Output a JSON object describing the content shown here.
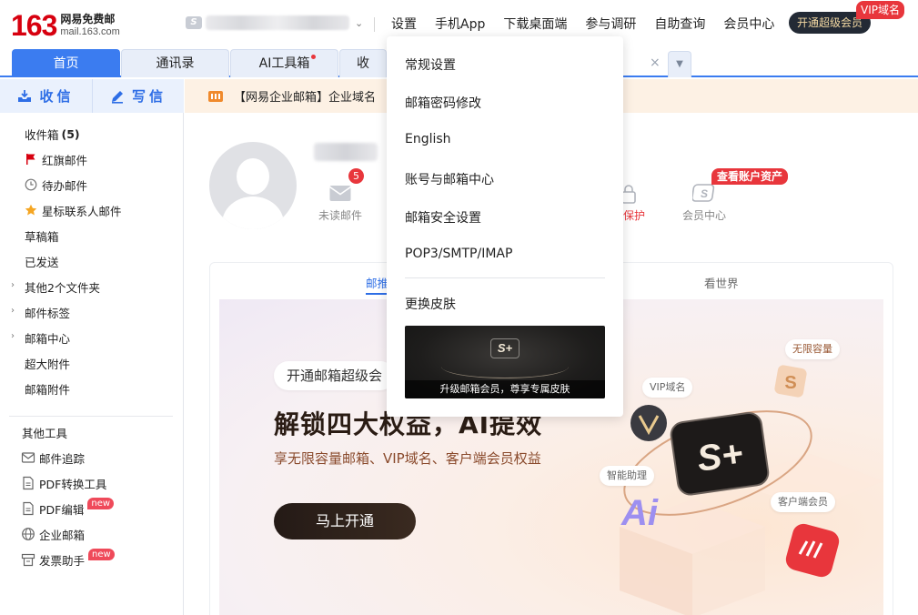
{
  "header": {
    "logo_number": "163",
    "logo_name": "网易免费邮",
    "logo_url": "mail.163.com",
    "account_badge": "S",
    "nav": [
      "设置",
      "手机App",
      "下载桌面端",
      "参与调研",
      "自助查询",
      "会员中心"
    ],
    "vip_button": "开通超级会员",
    "vip_tag": "VIP域名"
  },
  "tabs": [
    {
      "label": "首页",
      "active": true
    },
    {
      "label": "通讯录",
      "active": false
    },
    {
      "label": "AI工具箱",
      "active": false,
      "dot": true
    },
    {
      "label": "收",
      "active": false
    }
  ],
  "sidebar": {
    "receive": "收信",
    "write": "写信",
    "folders": [
      {
        "label": "收件箱",
        "count": "(5)",
        "icon": "none"
      },
      {
        "label": "红旗邮件",
        "icon": "red-flag-icon"
      },
      {
        "label": "待办邮件",
        "icon": "clock-icon"
      },
      {
        "label": "星标联系人邮件",
        "icon": "star-icon"
      },
      {
        "label": "草稿箱",
        "icon": "none"
      },
      {
        "label": "已发送",
        "icon": "none"
      },
      {
        "label": "其他2个文件夹",
        "icon": "chevron"
      },
      {
        "label": "邮件标签",
        "icon": "chevron"
      },
      {
        "label": "邮箱中心",
        "icon": "chevron"
      },
      {
        "label": "超大附件",
        "icon": "none"
      },
      {
        "label": "邮箱附件",
        "icon": "none"
      }
    ],
    "tools_title": "其他工具",
    "tools": [
      {
        "label": "邮件追踪",
        "icon": "mail-track-icon"
      },
      {
        "label": "PDF转换工具",
        "icon": "pdf-icon"
      },
      {
        "label": "PDF编辑",
        "icon": "pdf-icon",
        "new": "new"
      },
      {
        "label": "企业邮箱",
        "icon": "globe-icon"
      },
      {
        "label": "发票助手",
        "icon": "invoice-icon",
        "new": "new"
      }
    ]
  },
  "notice": {
    "text": "【网易企业邮箱】企业域名"
  },
  "stats": {
    "unread_count": "5",
    "unread_label": "未读邮件",
    "login_protect_label": "录保护",
    "member_label": "会员中心",
    "asset_tag": "查看账户资产"
  },
  "feed": {
    "tab_left": "邮推",
    "tab_right": "看世界"
  },
  "promo": {
    "pill": "开通邮箱超级会",
    "title": "解锁四大权益，AI提效",
    "subtitle": "享无限容量邮箱、VIP域名、客户端会员权益",
    "button": "马上开通",
    "chips": [
      "无限容量",
      "VIP域名",
      "智能助理",
      "客户端会员"
    ],
    "badge_text": "S+",
    "ai_text": "Ai"
  },
  "dropdown": {
    "items": [
      "常规设置",
      "邮箱密码修改",
      "English",
      "账号与邮箱中心",
      "邮箱安全设置",
      "POP3/SMTP/IMAP"
    ],
    "skin_label": "更换皮肤",
    "skin_logo": "S+",
    "skin_caption": "升级邮箱会员，尊享专属皮肤"
  },
  "colors": {
    "brand_red": "#d7000f",
    "tab_blue": "#3b7cf0",
    "link_blue": "#2e6ee6",
    "badge_red": "#e8363c"
  }
}
